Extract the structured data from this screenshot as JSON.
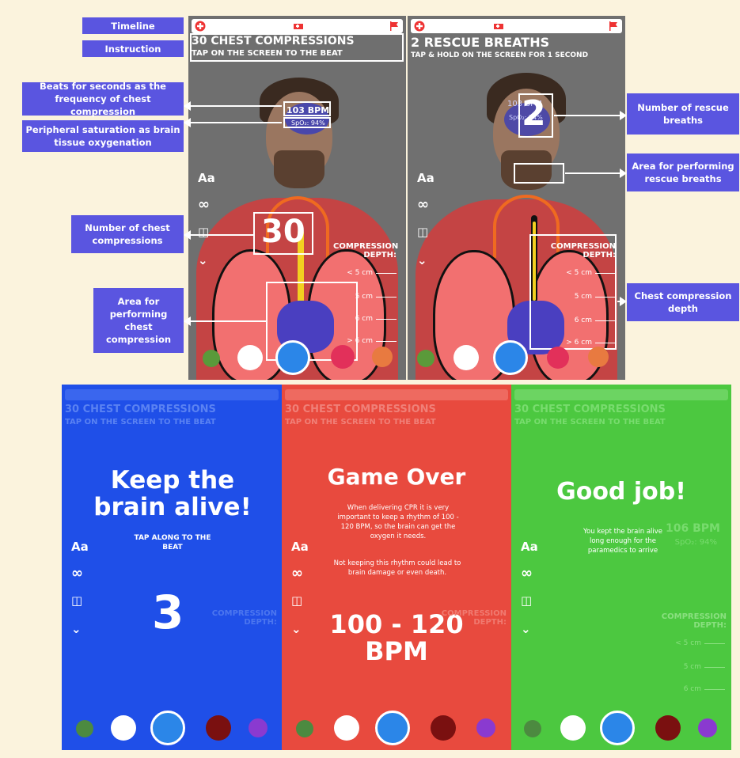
{
  "callouts": {
    "timeline": "Timeline",
    "instruction": "Instruction",
    "beats": "Beats for seconds as the frequency of chest compression",
    "spo2": "Peripheral saturation as brain tissue oxygenation",
    "chest_count": "Number of chest compressions",
    "chest_area": "Area for performing chest compression",
    "rescue_count": "Number of rescue breaths",
    "rescue_area": "Area for performing rescue breaths",
    "depth": "Chest compression depth"
  },
  "screen1": {
    "title": "30 CHEST COMPRESSIONS",
    "subtitle": "TAP ON THE SCREEN TO THE BEAT",
    "bpm": "103 BPM",
    "spo2": "SpO₂: 94%",
    "count": "30"
  },
  "screen2": {
    "title": "2 RESCUE BREATHS",
    "subtitle": "TAP & HOLD ON THE SCREEN FOR 1 SECOND",
    "bpm": "103 BPM",
    "spo2": "SpO₂: 94%",
    "count": "2"
  },
  "side_icons": {
    "text": "Aa",
    "loop": "∞",
    "layout": "◫",
    "more": "⌄"
  },
  "depth": {
    "label": "COMPRESSION DEPTH:",
    "rows": [
      "< 5 cm",
      "5 cm",
      "6 cm",
      "> 6 cm"
    ]
  },
  "blue": {
    "title_bg": "30 CHEST COMPRESSIONS",
    "subtitle_bg": "TAP ON THE SCREEN TO THE BEAT",
    "heading": "Keep the brain alive!",
    "sub": "TAP ALONG TO THE BEAT",
    "count": "3"
  },
  "red": {
    "title_bg": "30 CHEST COMPRESSIONS",
    "subtitle_bg": "TAP ON THE SCREEN TO THE BEAT",
    "heading": "Game Over",
    "p1": "When delivering CPR it is very important to keep a rhythm of 100 - 120 BPM, so the brain can get the oxygen it needs.",
    "p2": "Not keeping this rhythm could lead to brain damage or even death.",
    "range": "100 - 120",
    "unit": "BPM"
  },
  "green": {
    "title_bg": "30 CHEST COMPRESSIONS",
    "subtitle_bg": "TAP ON THE SCREEN TO THE BEAT",
    "heading": "Good job!",
    "p": "You kept the brain alive long enough for the paramedics to arrive",
    "bpm_bg": "106 BPM",
    "spo2_bg": "SpO₂: 94%"
  },
  "colors": {
    "callout": "#5a55e0",
    "blue": "#1f4fe8",
    "red": "#e84a3e",
    "green": "#4cc840"
  }
}
